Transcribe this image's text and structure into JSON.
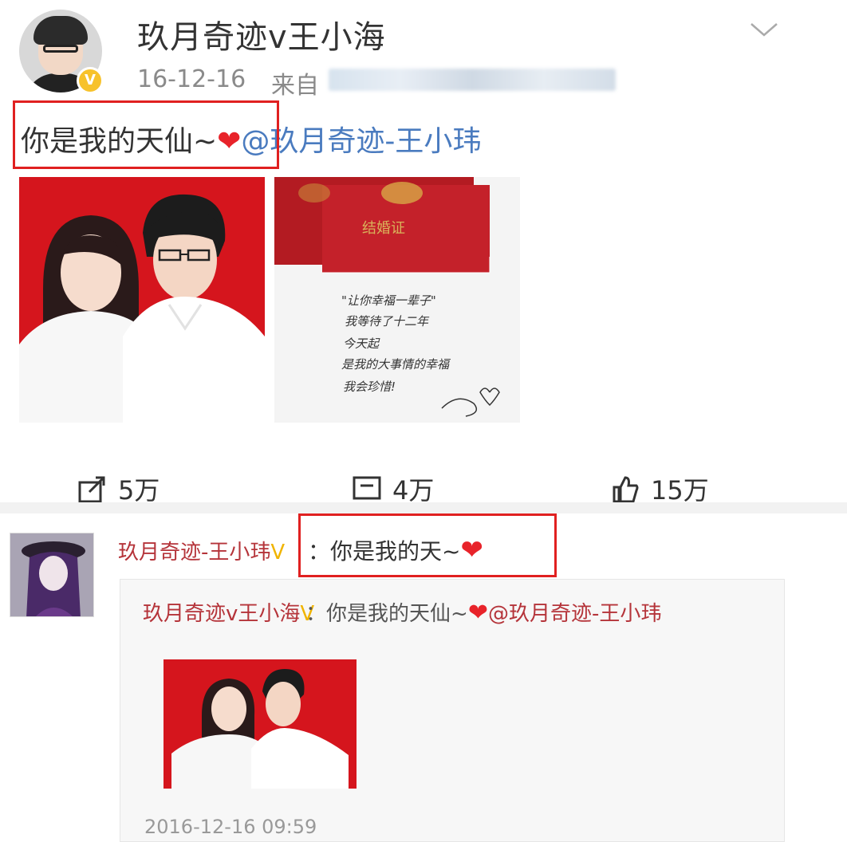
{
  "post": {
    "username": "玖月奇迹v王小海",
    "verified_badge": "V",
    "date": "16-12-16",
    "source_prefix": "来自",
    "text": "你是我的天仙~",
    "heart": "❤",
    "mention": "@玖月奇迹-王小玮",
    "certificate_title": "结婚证",
    "note_lines": [
      "\"让你幸福一辈子\"",
      "我等待了十二年",
      "今天起",
      "是我的大事情的幸福",
      "我会珍惜!"
    ]
  },
  "stats": {
    "repost": "5万",
    "comment": "4万",
    "like": "15万"
  },
  "comment": {
    "username": "玖月奇迹-王小玮",
    "verified_badge": "V",
    "separator": "：",
    "text": "你是我的天~",
    "heart": "❤",
    "repost": {
      "username": "玖月奇迹v王小海",
      "verified_badge": "V",
      "separator": "：",
      "text": "你是我的天仙~",
      "heart": "❤",
      "mention": "@玖月奇迹-王小玮",
      "timestamp": "2016-12-16 09:59"
    }
  },
  "colors": {
    "highlight_box": "#e02020",
    "mention": "#4a7bbf",
    "photo_background": "#d5151d",
    "verified_badge": "#f7c22b"
  }
}
